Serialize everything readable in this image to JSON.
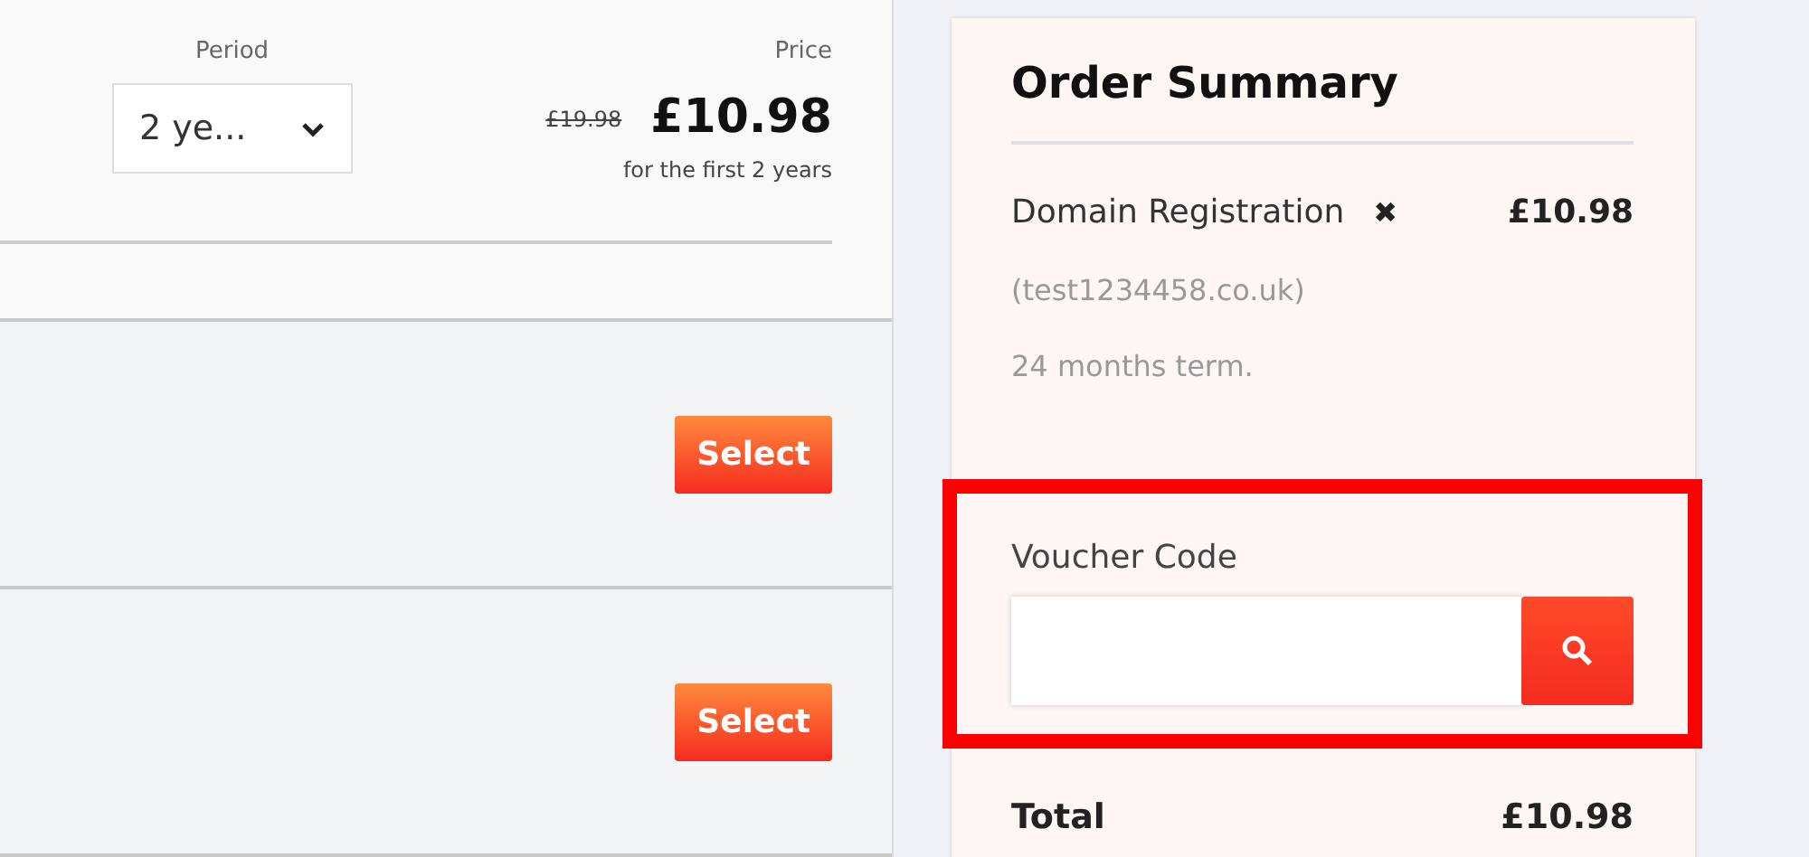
{
  "product": {
    "period_label": "Period",
    "price_label": "Price",
    "period_value": "2 ye...",
    "old_price": "£19.98",
    "price": "£10.98",
    "price_note": "for the first 2 years"
  },
  "offers": [
    {
      "button": "Select"
    },
    {
      "button": "Select"
    }
  ],
  "order_summary": {
    "title": "Order Summary",
    "items": [
      {
        "name": "Domain Registration",
        "remove": "✖",
        "price": "£10.98",
        "domain": "(test1234458.co.uk)",
        "term": "24 months term."
      }
    ],
    "voucher": {
      "label": "Voucher Code",
      "highlighted": true
    },
    "total_label": "Total",
    "total": "£10.98"
  }
}
